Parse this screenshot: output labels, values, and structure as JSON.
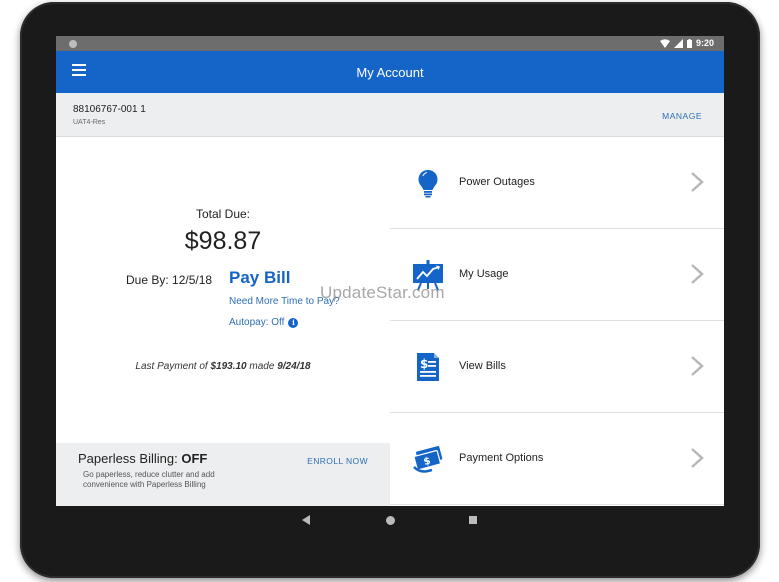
{
  "status_bar": {
    "time": "9:20"
  },
  "app_bar": {
    "title": "My Account",
    "menu_icon": "hamburger-icon"
  },
  "account": {
    "number": "88106767-001 1",
    "type": "UAT4-Res",
    "manage_label": "MANAGE"
  },
  "billing": {
    "total_due_label": "Total Due:",
    "total_due": "$98.87",
    "due_by": "Due By: 12/5/18",
    "pay_bill_label": "Pay Bill",
    "more_time_link": "Need More Time to Pay?",
    "autopay_label": "Autopay: Off",
    "last_payment_prefix": "Last Payment of ",
    "last_payment_amount": "$193.10",
    "last_payment_mid": " made ",
    "last_payment_date": "9/24/18"
  },
  "paperless": {
    "title": "Paperless Billing: ",
    "status": "OFF",
    "description": "Go paperless, reduce clutter and add convenience with Paperless Billing",
    "enroll_label": "ENROLL NOW"
  },
  "menu_items": [
    {
      "label": "Power Outages",
      "icon": "lightbulb-icon"
    },
    {
      "label": "My Usage",
      "icon": "usage-chart-icon"
    },
    {
      "label": "View Bills",
      "icon": "bill-document-icon"
    },
    {
      "label": "Payment Options",
      "icon": "payment-cash-icon"
    }
  ],
  "colors": {
    "brand_blue": "#1565c8",
    "link_blue": "#2d6fb5",
    "bar_gray": "#eceef0"
  },
  "watermark": "UpdateStar.com"
}
